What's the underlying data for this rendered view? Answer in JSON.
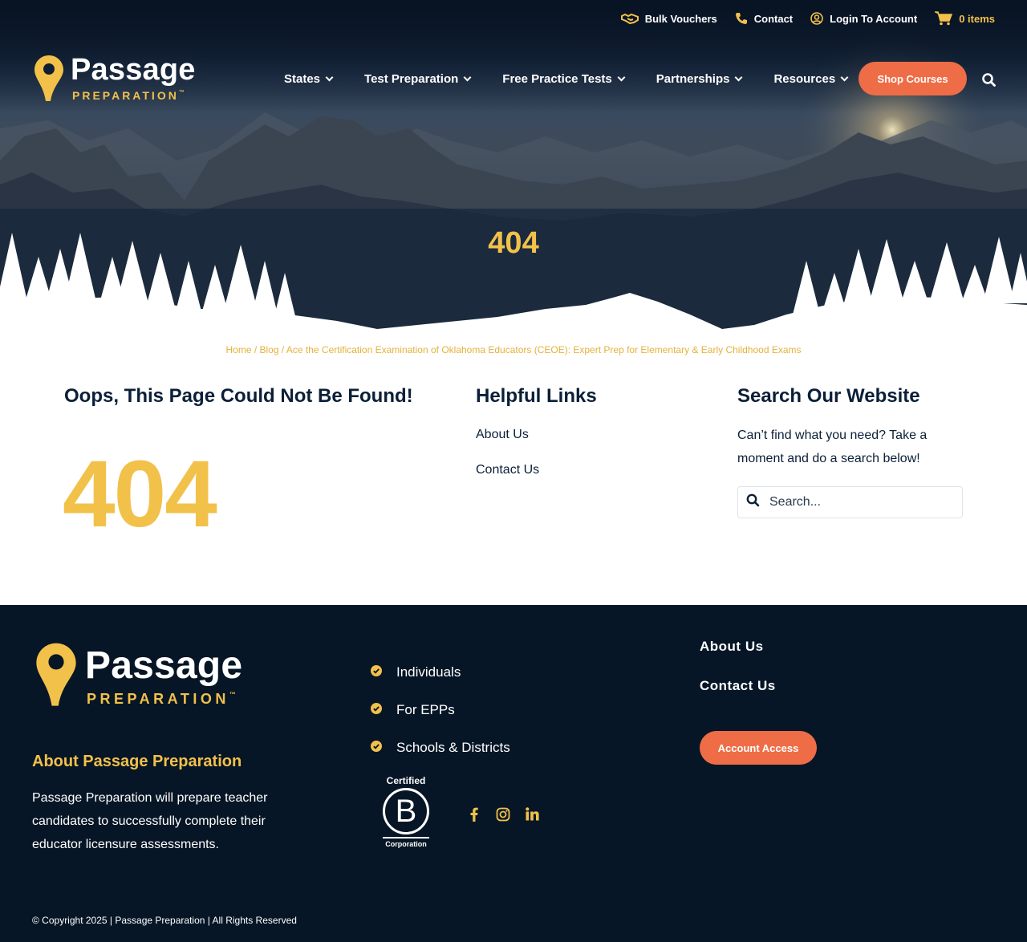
{
  "topbar": {
    "bulk_vouchers": "Bulk Vouchers",
    "contact": "Contact",
    "login": "Login To Account",
    "cart": "0 items"
  },
  "logo": {
    "word": "Passage",
    "sub": "PREPARATION",
    "tm": "™"
  },
  "nav": {
    "items": [
      {
        "label": "States"
      },
      {
        "label": "Test Preparation"
      },
      {
        "label": "Free Practice Tests"
      },
      {
        "label": "Partnerships"
      },
      {
        "label": "Resources"
      }
    ],
    "shop_label": "Shop Courses"
  },
  "hero": {
    "title": "404"
  },
  "breadcrumb": {
    "home": "Home",
    "sep": " / ",
    "blog": "Blog",
    "current": "Ace the Certification Examination of Oklahoma Educators (CEOE): Expert Prep for Elementary & Early Childhood Exams"
  },
  "notfound": {
    "title": "Oops, This Page Could Not Be Found!",
    "big": "404"
  },
  "helpful": {
    "title": "Helpful Links",
    "links": [
      "About Us",
      "Contact Us"
    ]
  },
  "search": {
    "title": "Search Our Website",
    "text_line1": "Can’t find what you need? Take a",
    "text_line2": "moment and do a search below!",
    "placeholder": "Search..."
  },
  "footer": {
    "about_heading": "About Passage Preparation",
    "about_line1": "Passage Preparation will prepare teacher",
    "about_line2": "candidates to successfully complete their",
    "about_line3": "educator licensure assessments.",
    "list": [
      "Individuals",
      "For EPPs",
      "Schools & Districts"
    ],
    "links": [
      "About Us",
      "Contact Us"
    ],
    "account_button": "Account Access",
    "bcorp": {
      "top": "Certified",
      "letter": "B",
      "bottom": "Corporation"
    },
    "copyright": "© Copyright 2025 | Passage Preparation | All Rights Reserved"
  },
  "colors": {
    "navy": "#071626",
    "gold": "#f2c14a",
    "orange": "#ee6d47"
  },
  "icons": [
    "handshake-icon",
    "phone-icon",
    "user-circle-icon",
    "cart-icon",
    "search-icon",
    "map-pin-icon",
    "check-circle-icon",
    "facebook-icon",
    "instagram-icon",
    "linkedin-icon"
  ]
}
